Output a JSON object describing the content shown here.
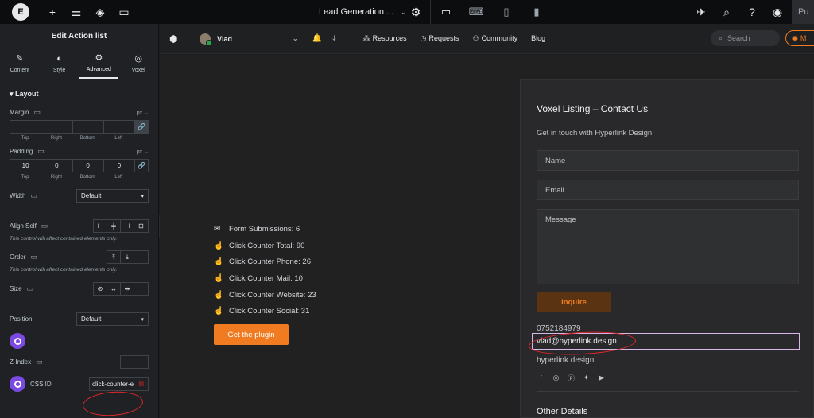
{
  "topbar": {
    "logo_text": "E",
    "document_title": "Lead Generation ...",
    "publish_label": "Pu"
  },
  "panel": {
    "title": "Edit Action list",
    "tabs": [
      {
        "label": "Content",
        "icon": "pencil-icon"
      },
      {
        "label": "Style",
        "icon": "half-circle-icon"
      },
      {
        "label": "Advanced",
        "icon": "gear-icon"
      },
      {
        "label": "Voxel",
        "icon": "voxel-icon"
      }
    ],
    "section": "Layout",
    "margin": {
      "label": "Margin",
      "unit": "px",
      "values": [
        "",
        "",
        "",
        ""
      ]
    },
    "padding": {
      "label": "Padding",
      "unit": "px",
      "values": [
        "10",
        "0",
        "0",
        "0"
      ]
    },
    "side_labels": [
      "Top",
      "Right",
      "Bottom",
      "Left"
    ],
    "width": {
      "label": "Width",
      "value": "Default"
    },
    "align_self": {
      "label": "Align Self",
      "note": "This control will affect contained elements only."
    },
    "order": {
      "label": "Order",
      "note": "This control will affect contained elements only."
    },
    "size": {
      "label": "Size"
    },
    "position": {
      "label": "Position",
      "value": "Default"
    },
    "zindex": {
      "label": "Z-Index",
      "value": ""
    },
    "css_id": {
      "label": "CSS ID",
      "value": "click-counter-e"
    }
  },
  "site_header": {
    "user_name": "Vlad",
    "nav": [
      {
        "label": "Resources",
        "icon": "grid-icon"
      },
      {
        "label": "Requests",
        "icon": "clock-icon"
      },
      {
        "label": "Community",
        "icon": "people-icon"
      },
      {
        "label": "Blog",
        "icon": ""
      }
    ],
    "search_placeholder": "Search",
    "account_label": "M"
  },
  "stats": [
    {
      "label": "Form Submissions: 6",
      "icon": "mail-icon"
    },
    {
      "label": "Click Counter Total: 90",
      "icon": "pointer-icon"
    },
    {
      "label": "Click Counter Phone: 26",
      "icon": "pointer-icon"
    },
    {
      "label": "Click Counter Mail: 10",
      "icon": "pointer-icon"
    },
    {
      "label": "Click Counter Website: 23",
      "icon": "pointer-icon"
    },
    {
      "label": "Click Counter Social: 31",
      "icon": "pointer-icon"
    }
  ],
  "get_plugin_label": "Get the plugin",
  "contact": {
    "title": "Voxel Listing – Contact Us",
    "subtitle": "Get in touch with Hyperlink Design",
    "name_placeholder": "Name",
    "email_placeholder": "Email",
    "message_placeholder": "Message",
    "submit_label": "Inquire",
    "phone": "0752184979",
    "email": "vlad@hyperlink.design",
    "website": "hyperlink.design",
    "socials": [
      "facebook-icon",
      "instagram-icon",
      "pinterest-icon",
      "twitter-icon",
      "youtube-icon"
    ],
    "other_details": "Other Details"
  },
  "colors": {
    "accent": "#f07b20",
    "annotation_red": "#e0272a",
    "voxel_purple": "#7b4ae2"
  }
}
